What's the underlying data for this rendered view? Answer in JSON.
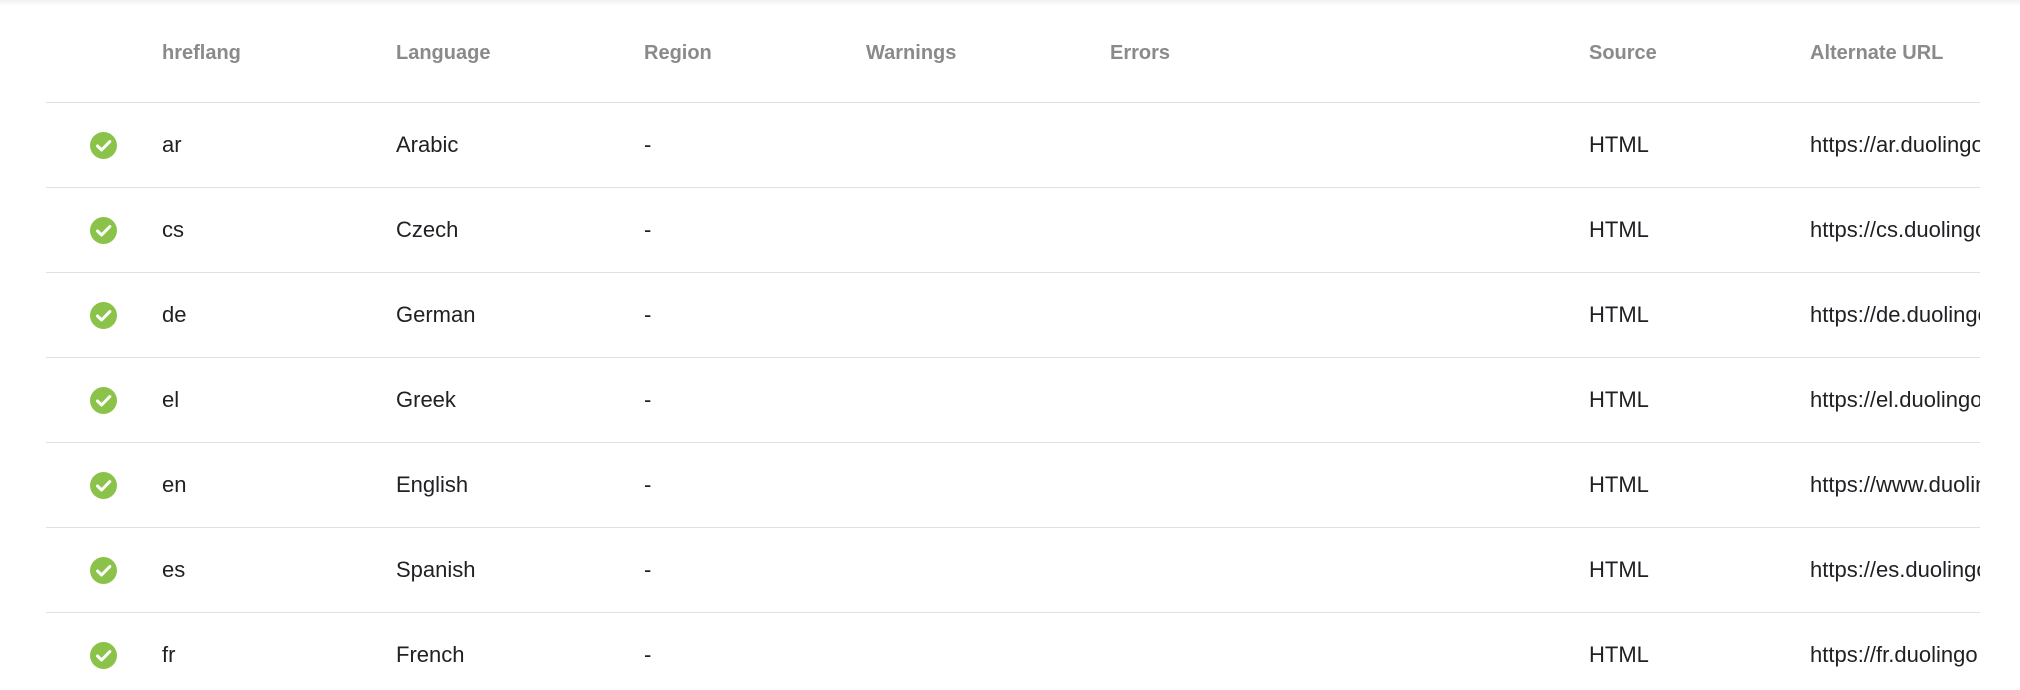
{
  "table": {
    "headers": {
      "status": "",
      "hreflang": "hreflang",
      "language": "Language",
      "region": "Region",
      "warnings": "Warnings",
      "errors": "Errors",
      "source": "Source",
      "alternate_url": "Alternate URL"
    },
    "status_color": "#8bc34a",
    "rows": [
      {
        "status_icon": "check-circle-icon",
        "hreflang": "ar",
        "language": "Arabic",
        "region": "-",
        "warnings": "",
        "errors": "",
        "source": "HTML",
        "alternate_url": "https://ar.duolingo"
      },
      {
        "status_icon": "check-circle-icon",
        "hreflang": "cs",
        "language": "Czech",
        "region": "-",
        "warnings": "",
        "errors": "",
        "source": "HTML",
        "alternate_url": "https://cs.duolingo"
      },
      {
        "status_icon": "check-circle-icon",
        "hreflang": "de",
        "language": "German",
        "region": "-",
        "warnings": "",
        "errors": "",
        "source": "HTML",
        "alternate_url": "https://de.duolingo"
      },
      {
        "status_icon": "check-circle-icon",
        "hreflang": "el",
        "language": "Greek",
        "region": "-",
        "warnings": "",
        "errors": "",
        "source": "HTML",
        "alternate_url": "https://el.duolingo"
      },
      {
        "status_icon": "check-circle-icon",
        "hreflang": "en",
        "language": "English",
        "region": "-",
        "warnings": "",
        "errors": "",
        "source": "HTML",
        "alternate_url": "https://www.duolingo"
      },
      {
        "status_icon": "check-circle-icon",
        "hreflang": "es",
        "language": "Spanish",
        "region": "-",
        "warnings": "",
        "errors": "",
        "source": "HTML",
        "alternate_url": "https://es.duolingo"
      },
      {
        "status_icon": "check-circle-icon",
        "hreflang": "fr",
        "language": "French",
        "region": "-",
        "warnings": "",
        "errors": "",
        "source": "HTML",
        "alternate_url": "https://fr.duolingo"
      }
    ]
  }
}
